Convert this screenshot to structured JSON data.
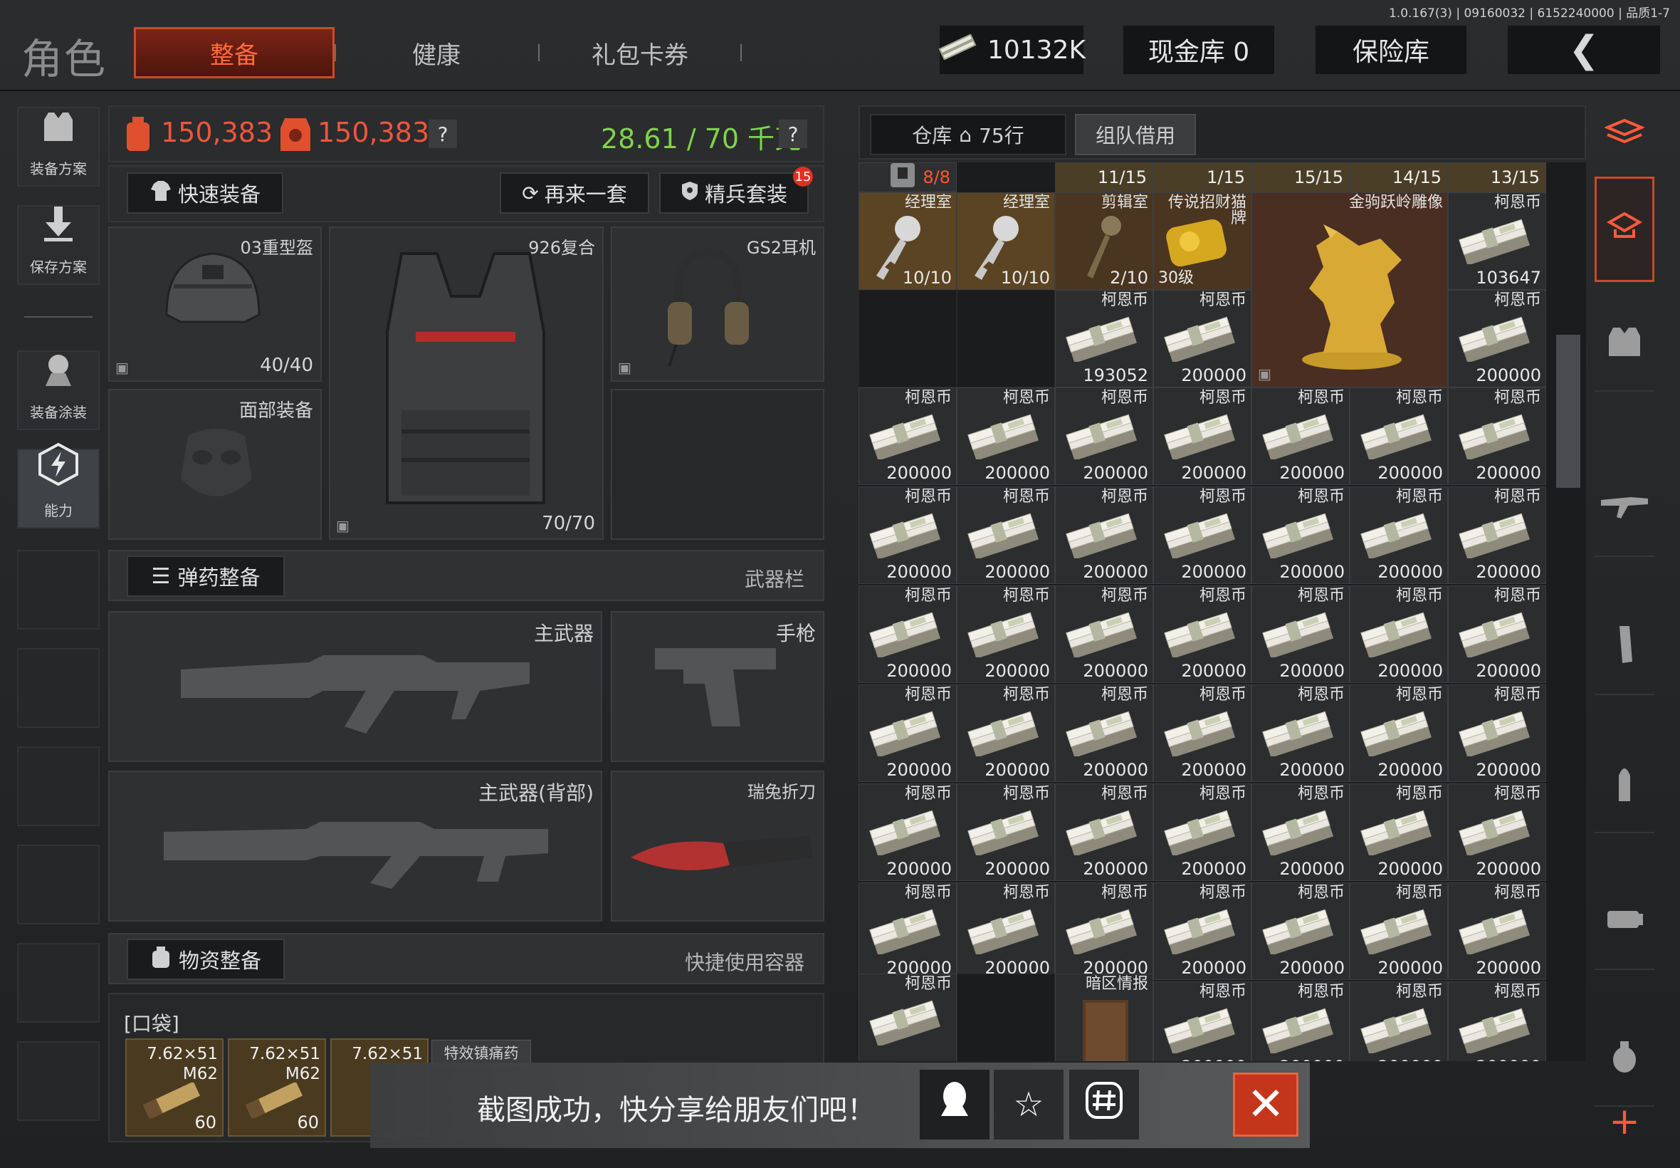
{
  "version_info": "1.0.167(3) | 09160032 | 6152240000 | 品质1-7",
  "header": {
    "title": "角色",
    "tabs": [
      {
        "label": "整备",
        "active": true
      },
      {
        "label": "健康",
        "active": false
      },
      {
        "label": "礼包卡券",
        "active": false
      }
    ],
    "currency": "10132K",
    "cash_vault": "现金库 0",
    "safe": "保险库",
    "back_icon": "chevron-left-icon"
  },
  "left_sidebar": {
    "items": [
      {
        "label": "装备方案",
        "icon": "vest-plan-icon"
      },
      {
        "label": "保存方案",
        "icon": "download-icon"
      },
      {
        "label": "装备涂装",
        "icon": "paint-icon"
      },
      {
        "label": "能力",
        "icon": "lightning-icon"
      }
    ]
  },
  "stats": {
    "value_bag": "150,383",
    "value_total": "150,383",
    "weight": "28.61 / 70 千克",
    "help": "?"
  },
  "actions": {
    "quick_equip": "快速装备",
    "again": "再来一套",
    "elite": "精兵套装",
    "elite_badge": "15"
  },
  "gear": {
    "helmet": {
      "label": "03重型盔",
      "count": "40/40"
    },
    "armor": {
      "label": "926复合",
      "count": "70/70"
    },
    "headset": {
      "label": "GS2耳机"
    },
    "face": {
      "label": "面部装备"
    }
  },
  "ammo_section": {
    "button": "弹药整备",
    "right_label": "武器栏"
  },
  "weapons": {
    "primary": "主武器",
    "pistol": "手枪",
    "back": "主武器(背部)",
    "knife": "瑞兔折刀"
  },
  "supply_section": {
    "button": "物资整备",
    "right_label": "快捷使用容器"
  },
  "pocket": {
    "title": "[口袋]",
    "items": [
      {
        "name": "7.62×51",
        "sub": "M62",
        "qty": "60"
      },
      {
        "name": "7.62×51",
        "sub": "M62",
        "qty": "60"
      },
      {
        "name": "7.62×51",
        "sub": "",
        "qty": ""
      }
    ],
    "special": "特效镇痛药"
  },
  "inventory": {
    "tab_warehouse": "仓库",
    "rows": "75行",
    "tab_team": "组队借用",
    "capacity_row": [
      "8/8",
      "",
      "11/15",
      "1/15",
      "15/15",
      "14/15",
      "13/15"
    ],
    "row1": [
      {
        "name": "经理室",
        "qty": "10/10"
      },
      {
        "name": "经理室",
        "qty": "10/10"
      },
      {
        "name": "剪辑室",
        "qty": "2/10"
      },
      {
        "name": "传说招财猫牌",
        "lvl": "30级"
      },
      {
        "name": "金驹跃岭雕像"
      },
      {
        "name": "柯恩币",
        "val": "103647"
      }
    ],
    "row2": [
      {
        "name": "柯恩币",
        "val": "193052"
      },
      {
        "name": "柯恩币",
        "val": "200000"
      },
      {
        "name": "柯恩币",
        "val": "200000"
      }
    ],
    "coin_name": "柯恩币",
    "coin_value": "200000",
    "last_row_special": "暗区情报"
  },
  "right_sidebar": {
    "icons": [
      "stack-icon",
      "hat-icon",
      "vest-icon",
      "rifle-icon",
      "magazine-icon",
      "bullet-icon",
      "scope-icon",
      "grenade-icon",
      "plus-icon"
    ]
  },
  "toast": {
    "message": "截图成功，快分享给朋友们吧！",
    "close": "✕"
  }
}
